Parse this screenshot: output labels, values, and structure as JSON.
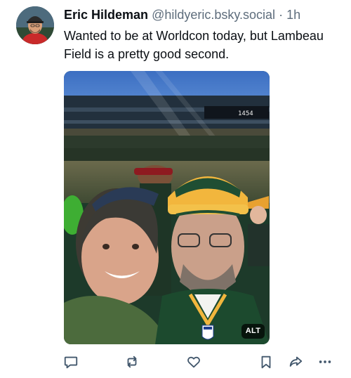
{
  "post": {
    "author_name": "Eric Hildeman",
    "handle": "@hildyeric.bsky.social",
    "separator": "·",
    "time": "1h",
    "text": "Wanted to be at Worldcon today, but Lambeau Field is a pretty good second.",
    "media": {
      "alt_badge": "ALT",
      "scoreboard_text": "1454"
    }
  },
  "colors": {
    "accent": "#1083fe",
    "text_primary": "#0b0f14",
    "text_muted": "#5e6d7c",
    "icon": "#42576c"
  },
  "icons": [
    "reply-icon",
    "repost-icon",
    "like-icon",
    "bookmark-icon",
    "share-icon",
    "more-icon"
  ]
}
